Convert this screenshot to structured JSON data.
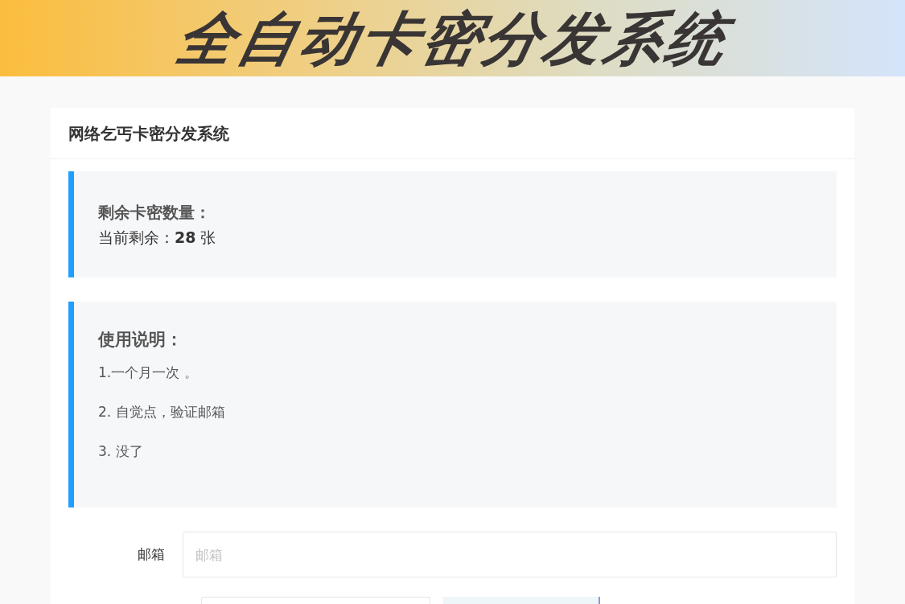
{
  "banner": {
    "title": "全自动卡密分发系统"
  },
  "card": {
    "title": "网络乞丐卡密分发系统"
  },
  "stock": {
    "heading": "剩余卡密数量：",
    "text": "当前剩余：**28** 张"
  },
  "instructions": {
    "heading": "使用说明：",
    "items": [
      "1.一个月一次 。",
      "2. 自觉点，验证邮箱",
      "3. 没了"
    ]
  },
  "form": {
    "fields": [
      {
        "kind": "text",
        "label": "邮箱",
        "placeholder": "邮箱"
      },
      {
        "kind": "captcha"
      }
    ]
  }
}
